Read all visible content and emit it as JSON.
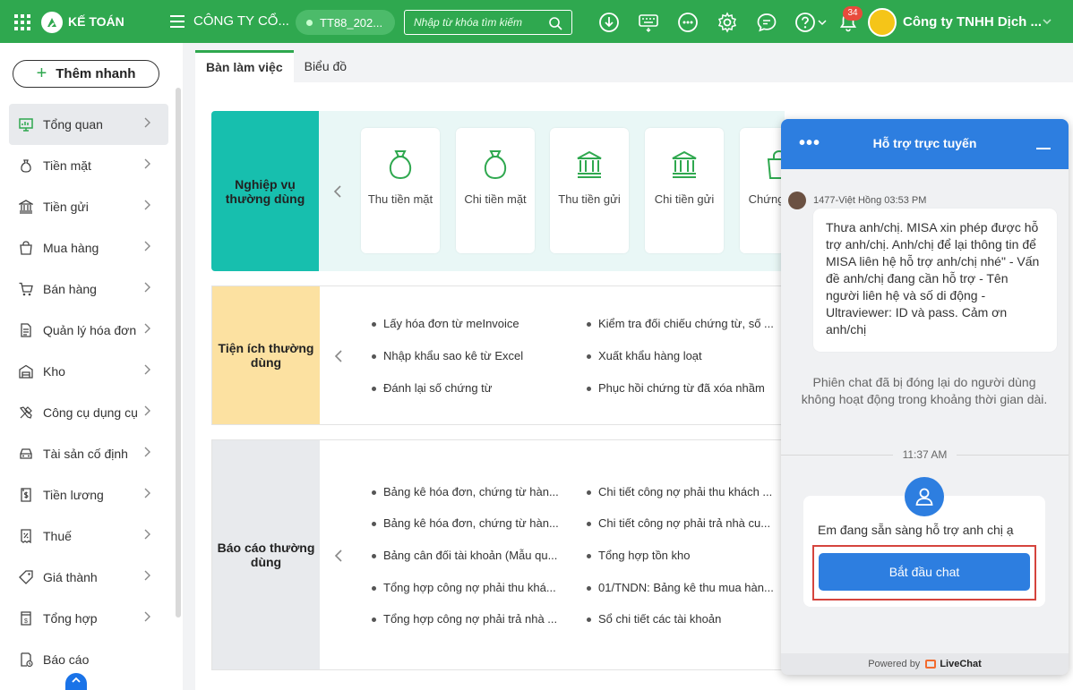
{
  "header": {
    "app_name": "KẾ TOÁN",
    "company": "CÔNG TY CỔ...",
    "database": "TT88_202...",
    "search_placeholder": "Nhập từ khóa tìm kiếm",
    "notification_count": "34",
    "user_name": "Công ty TNHH Dịch ...",
    "brand_color": "#2fa84f"
  },
  "sidebar": {
    "quick_add": "Thêm nhanh",
    "items": [
      {
        "label": "Tổng quan",
        "icon": "dashboard-icon"
      },
      {
        "label": "Tiền mặt",
        "icon": "money-bag-icon"
      },
      {
        "label": "Tiền gửi",
        "icon": "bank-icon"
      },
      {
        "label": "Mua hàng",
        "icon": "shopping-bag-icon"
      },
      {
        "label": "Bán hàng",
        "icon": "cart-icon"
      },
      {
        "label": "Quản lý hóa đơn",
        "icon": "invoice-icon"
      },
      {
        "label": "Kho",
        "icon": "warehouse-icon"
      },
      {
        "label": "Công cụ dụng cụ",
        "icon": "tools-icon"
      },
      {
        "label": "Tài sản cố định",
        "icon": "car-icon"
      },
      {
        "label": "Tiền lương",
        "icon": "salary-icon"
      },
      {
        "label": "Thuế",
        "icon": "tax-icon"
      },
      {
        "label": "Giá thành",
        "icon": "price-tag-icon"
      },
      {
        "label": "Tổng hợp",
        "icon": "summary-icon"
      },
      {
        "label": "Báo cáo",
        "icon": "report-icon"
      }
    ]
  },
  "tabs": [
    {
      "label": "Bàn làm việc"
    },
    {
      "label": "Biểu đồ"
    }
  ],
  "operations": {
    "title": "Nghiệp vụ thường dùng",
    "cards": [
      {
        "label": "Thu tiền mặt",
        "icon": "money-bag-icon"
      },
      {
        "label": "Chi tiền mặt",
        "icon": "money-bag-icon"
      },
      {
        "label": "Thu tiền gửi",
        "icon": "bank-icon"
      },
      {
        "label": "Chi tiền gửi",
        "icon": "bank-icon"
      },
      {
        "label": "Chứng mua",
        "icon": "shopping-bag-icon"
      }
    ]
  },
  "utilities": {
    "title": "Tiện ích thường dùng",
    "links": [
      "Lấy hóa đơn từ meInvoice",
      "Kiểm tra đối chiếu chứng từ, số ...",
      "Nhập khẩu sao kê từ Excel",
      "Xuất khẩu hàng loạt",
      "Đánh lại số chứng từ",
      "Phục hồi chứng từ đã xóa nhầm"
    ]
  },
  "reports": {
    "title": "Báo cáo thường dùng",
    "links": [
      "Bảng kê hóa đơn, chứng từ hàn...",
      "Chi tiết công nợ phải thu khách ...",
      "Bảng kê hóa đơn, chứng từ hàn...",
      "Chi tiết công nợ phải trả nhà cu...",
      "Bảng cân đối tài khoản (Mẫu qu...",
      "Tổng hợp tồn kho",
      "Tổng hợp công nợ phải thu khá...",
      "01/TNDN: Bảng kê thu mua hàn...",
      "Tổng hợp công nợ phải trả nhà ...",
      "Sổ chi tiết các tài khoản"
    ]
  },
  "chat": {
    "title": "Hỗ trợ trực tuyến",
    "agent_line": "1477-Việt Hồng 03:53 PM",
    "message": "Thưa anh/chị. MISA xin phép được hỗ trợ anh/chị. Anh/chị để lại thông tin để MISA liên hệ hỗ trợ anh/chị nhé\" - Vấn đề anh/chị đang cần hỗ trợ - Tên người liên hệ và số di động - Ultraviewer: ID và pass. Cảm ơn anh/chị",
    "system_message": "Phiên chat đã bị đóng lại do người dùng không hoạt động trong khoảng thời gian dài.",
    "time": "11:37 AM",
    "ready_text": "Em đang sẵn sàng hỗ trợ anh chị ạ",
    "start_button": "Bắt đầu chat",
    "powered_by": "Powered by",
    "provider": "LiveChat",
    "accent_color": "#2d7ee0"
  }
}
